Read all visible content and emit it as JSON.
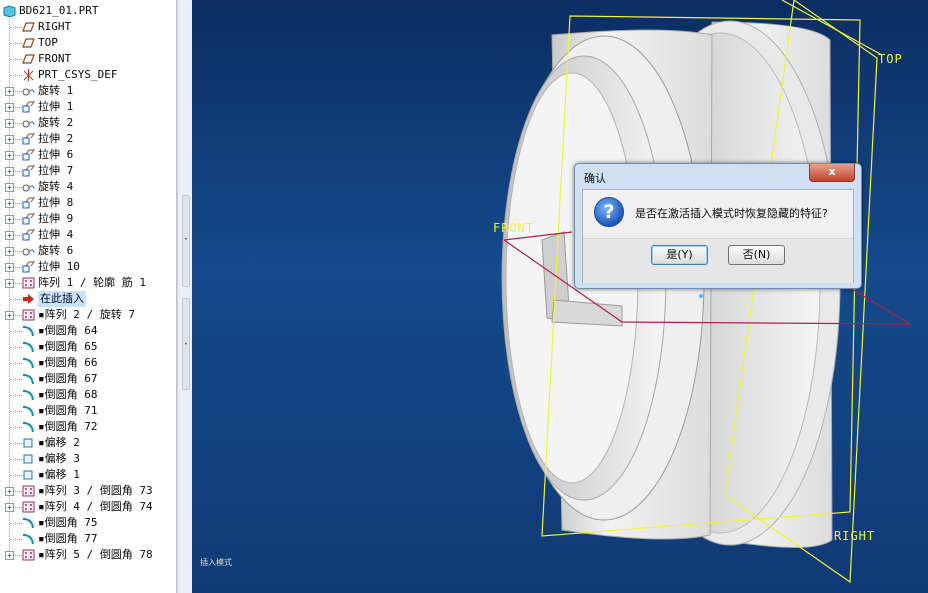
{
  "tree": {
    "root": "BD621_01.PRT",
    "items": [
      {
        "label": "RIGHT",
        "icon": "datum-plane-icon",
        "expander": false
      },
      {
        "label": "TOP",
        "icon": "datum-plane-icon",
        "expander": false
      },
      {
        "label": "FRONT",
        "icon": "datum-plane-icon",
        "expander": false
      },
      {
        "label": "PRT_CSYS_DEF",
        "icon": "csys-icon",
        "expander": false
      },
      {
        "label": "旋转 1",
        "icon": "revolve-icon",
        "expander": true
      },
      {
        "label": "拉伸 1",
        "icon": "extrude-icon",
        "expander": true
      },
      {
        "label": "旋转 2",
        "icon": "revolve-icon",
        "expander": true
      },
      {
        "label": "拉伸 2",
        "icon": "extrude-icon",
        "expander": true
      },
      {
        "label": "拉伸 6",
        "icon": "extrude-icon",
        "expander": true
      },
      {
        "label": "拉伸 7",
        "icon": "extrude-icon",
        "expander": true
      },
      {
        "label": "旋转 4",
        "icon": "revolve-icon",
        "expander": true
      },
      {
        "label": "拉伸 8",
        "icon": "extrude-icon",
        "expander": true
      },
      {
        "label": "拉伸 9",
        "icon": "extrude-icon",
        "expander": true
      },
      {
        "label": "拉伸 4",
        "icon": "extrude-icon",
        "expander": true
      },
      {
        "label": "旋转 6",
        "icon": "revolve-icon",
        "expander": true
      },
      {
        "label": "拉伸 10",
        "icon": "extrude-icon",
        "expander": true
      },
      {
        "label": "阵列 1 / 轮廓 筋 1",
        "icon": "pattern-icon",
        "expander": true
      },
      {
        "label": "在此插入",
        "icon": "insert-arrow-icon",
        "expander": false,
        "selected": true
      },
      {
        "label": "▪阵列 2 / 旋转 7",
        "icon": "pattern-icon",
        "expander": true
      },
      {
        "label": "▪倒圆角 64",
        "icon": "round-icon",
        "expander": false
      },
      {
        "label": "▪倒圆角 65",
        "icon": "round-icon",
        "expander": false
      },
      {
        "label": "▪倒圆角 66",
        "icon": "round-icon",
        "expander": false
      },
      {
        "label": "▪倒圆角 67",
        "icon": "round-icon",
        "expander": false
      },
      {
        "label": "▪倒圆角 68",
        "icon": "round-icon",
        "expander": false
      },
      {
        "label": "▪倒圆角 71",
        "icon": "round-icon",
        "expander": false
      },
      {
        "label": "▪倒圆角 72",
        "icon": "round-icon",
        "expander": false
      },
      {
        "label": "▪偏移 2",
        "icon": "offset-icon",
        "expander": false
      },
      {
        "label": "▪偏移 3",
        "icon": "offset-icon",
        "expander": false
      },
      {
        "label": "▪偏移 1",
        "icon": "offset-icon",
        "expander": false
      },
      {
        "label": "▪阵列 3 / 倒圆角 73",
        "icon": "pattern-icon",
        "expander": true
      },
      {
        "label": "▪阵列 4 / 倒圆角 74",
        "icon": "pattern-icon",
        "expander": true
      },
      {
        "label": "▪倒圆角 75",
        "icon": "round-icon",
        "expander": false
      },
      {
        "label": "▪倒圆角 77",
        "icon": "round-icon",
        "expander": false
      },
      {
        "label": "▪阵列 5 / 倒圆角 78",
        "icon": "pattern-icon",
        "expander": true
      }
    ]
  },
  "viewport": {
    "planes": {
      "top": "TOP",
      "front": "FRONT",
      "right": "RIGHT"
    },
    "mode_label": "插入模式"
  },
  "dialog": {
    "title": "确认",
    "close": "x",
    "icon": "question-icon",
    "message": "是否在激活插入模式时恢复隐藏的特征?",
    "yes": "是(Y)",
    "no": "否(N)"
  },
  "colors": {
    "viewport_bg": "#154a8c",
    "plane": "#f1f23a",
    "selection": "#c7e3ff",
    "dialog_frame": "#cfe0f2"
  }
}
